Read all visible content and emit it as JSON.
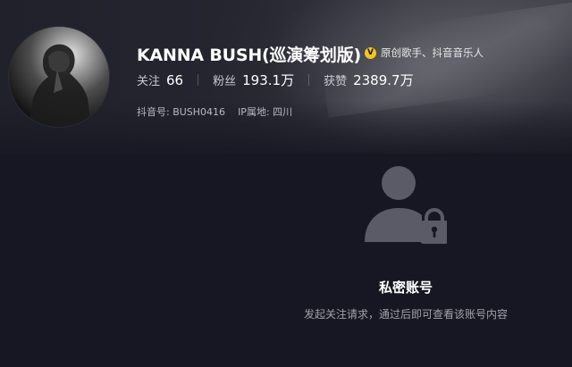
{
  "profile": {
    "name": "KANNA BUSH(巡演筹划版)",
    "verification": "原创歌手、抖音音乐人",
    "verified_icon": "verified-badge-icon",
    "verified_color": "#f5c518"
  },
  "stats": {
    "following_label": "关注",
    "following_value": "66",
    "followers_label": "粉丝",
    "followers_value": "193.1万",
    "likes_label": "获赞",
    "likes_value": "2389.7万"
  },
  "meta": {
    "douyin_id": "抖音号: BUSH0416",
    "ip_location": "IP属地: 四川"
  },
  "private": {
    "icon": "private-user-lock-icon",
    "title": "私密账号",
    "description": "发起关注请求，通过后即可查看该账号内容"
  },
  "colors": {
    "background": "#161722",
    "text_primary": "#ffffff",
    "text_secondary": "#a2a3aa"
  }
}
